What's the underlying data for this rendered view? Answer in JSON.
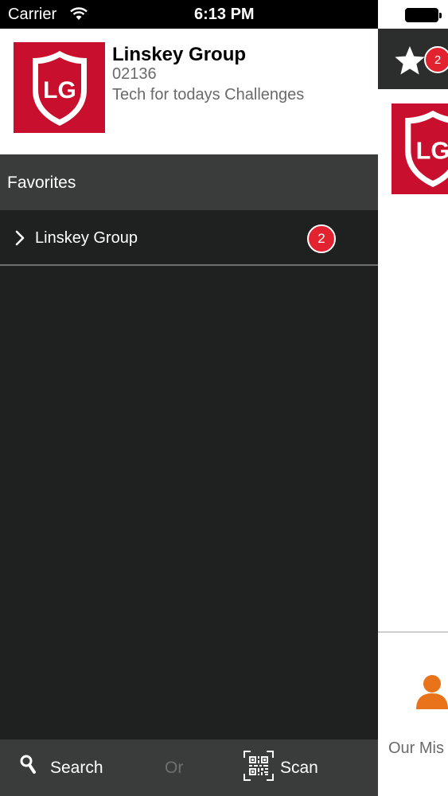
{
  "status_bar": {
    "carrier": "Carrier",
    "time": "6:13 PM"
  },
  "profile": {
    "name": "Linskey Group",
    "zip": "02136",
    "tagline": "Tech for todays Challenges",
    "logo_text": "LG"
  },
  "favorites": {
    "title": "Favorites",
    "items": [
      {
        "label": "Linskey Group",
        "badge": "2"
      }
    ]
  },
  "footer": {
    "search_label": "Search",
    "or_label": "Or",
    "scan_label": "Scan"
  },
  "main_panel": {
    "favorites_badge": "2",
    "logo_text": "LG",
    "mission_label": "Our Mis"
  },
  "colors": {
    "brand_red": "#c8102e",
    "badge_red": "#e2222e",
    "drawer_bg": "#1f2020",
    "section_bg": "#3a3c3c",
    "accent_orange": "#e8731a"
  },
  "icons": {
    "wifi": "wifi-icon",
    "chevron": "chevron-right-icon",
    "search": "search-icon",
    "scan": "qr-code-icon",
    "star": "star-icon",
    "person": "person-icon",
    "battery": "battery-icon",
    "logo": "shield-logo-icon"
  }
}
